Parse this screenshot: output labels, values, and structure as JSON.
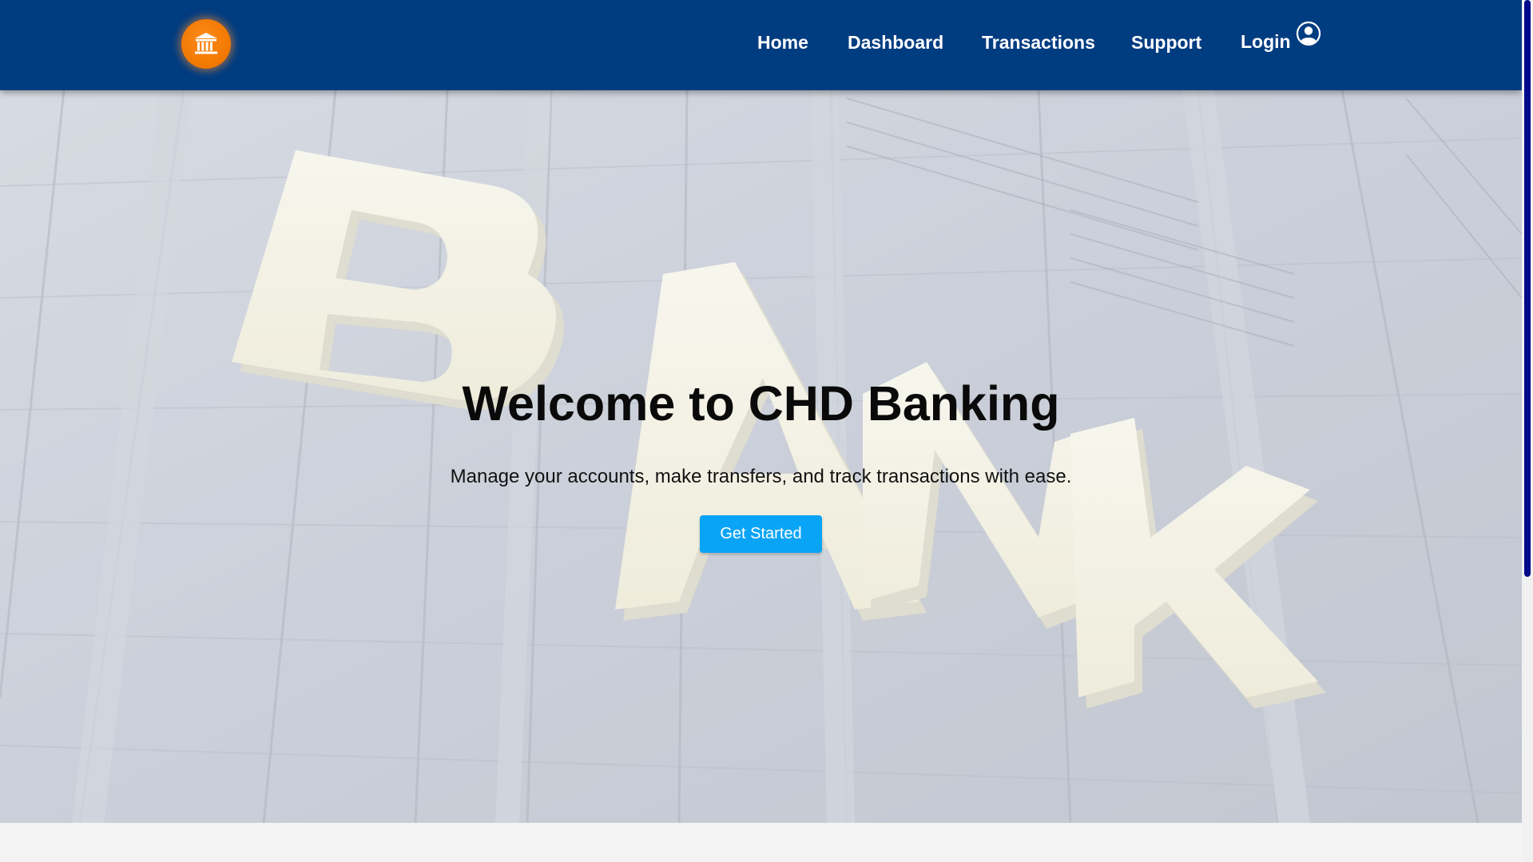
{
  "brand": {
    "logo_icon": "bank-building-icon",
    "logo_color": "#f07800"
  },
  "nav": {
    "background": "#003c80",
    "items": [
      {
        "label": "Home"
      },
      {
        "label": "Dashboard"
      },
      {
        "label": "Transactions"
      },
      {
        "label": "Support"
      },
      {
        "label": "Login",
        "icon": "user-circle-icon"
      }
    ]
  },
  "hero": {
    "background_image": "bank-building-facade",
    "sign_text": "BANK",
    "title": "Welcome to CHD Banking",
    "subtitle": "Manage your accounts, make transfers, and track transactions with ease.",
    "cta_label": "Get Started",
    "cta_color": "#0aa4f6"
  },
  "scrollbar": {
    "thumb_color": "#000a8c"
  }
}
